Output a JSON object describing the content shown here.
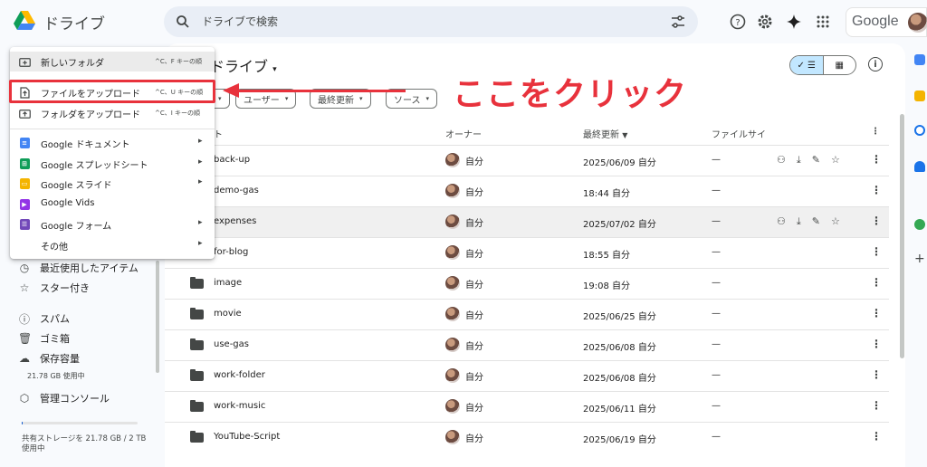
{
  "header": {
    "app_title": "ドライブ",
    "search_placeholder": "ドライブで検索",
    "account_label": "Google"
  },
  "sidebar": {
    "items": [
      {
        "label": "最近使用したアイテム",
        "icon": "clock-icon"
      },
      {
        "label": "スター付き",
        "icon": "star-icon"
      },
      {
        "label": "スパム",
        "icon": "spam-icon"
      },
      {
        "label": "ゴミ箱",
        "icon": "trash-icon"
      },
      {
        "label": "保存容量",
        "icon": "cloud-icon"
      },
      {
        "label": "管理コンソール",
        "icon": "admin-icon"
      }
    ],
    "storage_used": "21.78 GB 使用中",
    "storage_fraction": 0.01,
    "storage_text": "共有ストレージを 21.78 GB / 2 TB 使用中"
  },
  "main": {
    "title": "ドライブ",
    "filters": [
      "ユーザー",
      "最終更新",
      "ソース"
    ],
    "columns": {
      "name": "ト",
      "owner": "オーナー",
      "modified": "最終更新",
      "size": "ファイルサイ"
    },
    "rows": [
      {
        "name": "back-up",
        "owner": "自分",
        "modified": "2025/06/09 自分",
        "size": "—"
      },
      {
        "name": "demo-gas",
        "owner": "自分",
        "modified": "18:44 自分",
        "size": "—"
      },
      {
        "name": "expenses",
        "owner": "自分",
        "modified": "2025/07/02 自分",
        "size": "—"
      },
      {
        "name": "for-blog",
        "owner": "自分",
        "modified": "18:55 自分",
        "size": "—"
      },
      {
        "name": "image",
        "owner": "自分",
        "modified": "19:08 自分",
        "size": "—"
      },
      {
        "name": "movie",
        "owner": "自分",
        "modified": "2025/06/25 自分",
        "size": "—"
      },
      {
        "name": "use-gas",
        "owner": "自分",
        "modified": "2025/06/08 自分",
        "size": "—"
      },
      {
        "name": "work-folder",
        "owner": "自分",
        "modified": "2025/06/08 自分",
        "size": "—"
      },
      {
        "name": "work-music",
        "owner": "自分",
        "modified": "2025/06/11 自分",
        "size": "—"
      },
      {
        "name": "YouTube-Script",
        "owner": "自分",
        "modified": "2025/06/19 自分",
        "size": "—"
      }
    ]
  },
  "menu": {
    "items": [
      {
        "label": "新しいフォルダ",
        "shortcut": "^C、F キーの順"
      },
      {
        "label": "ファイルをアップロード",
        "shortcut": "^C、U キーの順"
      },
      {
        "label": "フォルダをアップロード",
        "shortcut": "^C、I キーの順"
      },
      {
        "label": "Google ドキュメント"
      },
      {
        "label": "Google スプレッドシート"
      },
      {
        "label": "Google スライド"
      },
      {
        "label": "Google Vids"
      },
      {
        "label": "Google フォーム"
      },
      {
        "label": "その他"
      }
    ]
  },
  "annotation": {
    "text": "ここをクリック",
    "color": "#e8323c"
  },
  "colors": {
    "accent_blue": "#0b57d0",
    "selected_toggle": "#c2e7ff",
    "docs_blue": "#4285f4",
    "sheets_green": "#0f9d58",
    "slides_yellow": "#f4b400",
    "vids_purple": "#9334e6",
    "forms_purple": "#7248b9"
  }
}
